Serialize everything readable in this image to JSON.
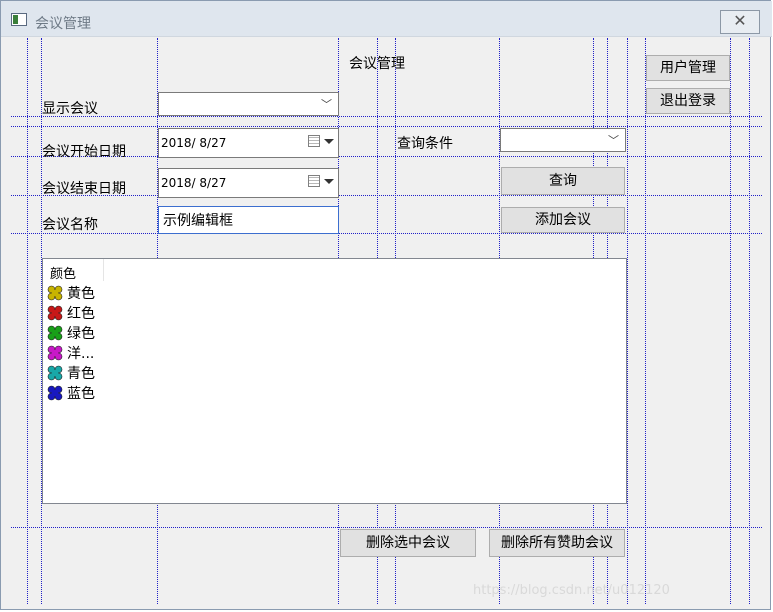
{
  "window": {
    "title": "会议管理",
    "close_glyph": "✕"
  },
  "form": {
    "header_label": "会议管理",
    "show_meeting_label": "显示会议",
    "show_meeting_value": "",
    "start_date_label": "会议开始日期",
    "start_date_value": "2018/  8/27",
    "end_date_label": "会议结束日期",
    "end_date_value": "2018/  8/27",
    "meeting_name_label": "会议名称",
    "meeting_name_value": "示例编辑框",
    "query_condition_label": "查询条件",
    "query_condition_value": ""
  },
  "buttons": {
    "user_manage": "用户管理",
    "logout": "退出登录",
    "query": "查询",
    "add_meeting": "添加会议",
    "delete_selected": "删除选中会议",
    "delete_all_sponsors": "删除所有赞助会议"
  },
  "list": {
    "column_header": "颜色",
    "items": [
      {
        "label": "黄色",
        "color": "#c8b400"
      },
      {
        "label": "红色",
        "color": "#c81818"
      },
      {
        "label": "绿色",
        "color": "#18a018"
      },
      {
        "label": "洋...",
        "color": "#c818c8"
      },
      {
        "label": "青色",
        "color": "#18a8a8"
      },
      {
        "label": "蓝色",
        "color": "#1818c0"
      }
    ]
  },
  "watermark": "https://blog.csdn.net/u012120"
}
